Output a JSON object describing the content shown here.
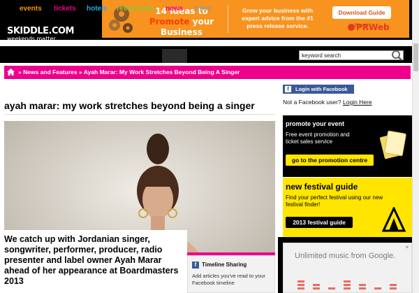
{
  "site": {
    "logo": "SKIDDLE.COM",
    "tagline": "weekends matter"
  },
  "ad": {
    "headline_number": "14 Ideas to",
    "headline_promote": "Promote",
    "headline_rest": "your Business",
    "body": "Grow your business with expert advice from the #1 press release service.",
    "button": "Download Guide Now!",
    "brand": "PRWeb",
    "close": "×"
  },
  "nav": {
    "items": [
      {
        "label": "events",
        "color": "#f7941d"
      },
      {
        "label": "tickets",
        "color": "#ec008c"
      },
      {
        "label": "hotels",
        "color": "#29abe2"
      },
      {
        "label": "restaurants",
        "color": "#8dc63f"
      },
      {
        "label": "news",
        "color": "#ec008c"
      },
      {
        "label": "cities",
        "color": "#999999"
      }
    ],
    "search_placeholder": "keyword search"
  },
  "breadcrumb": {
    "sep1": "»",
    "section": "News and Features",
    "sep2": "»",
    "current": "Ayah Marar: My Work Stretches Beyond Being A Singer"
  },
  "article": {
    "title": "ayah marar: my work stretches beyond being a singer",
    "caption": "We catch up with Jordanian singer, songwriter, performer, producer, radio presenter and label owner Ayah Marar ahead of her appearance at Boardmasters 2013"
  },
  "timeline": {
    "icon": "f",
    "title": "Timeline Sharing",
    "text": "Add articles you've read to your Facebook timeline"
  },
  "facebook": {
    "button": "Login with Facebook",
    "note_prefix": "Not a Facebook user?",
    "note_link": "Login Here"
  },
  "promo": {
    "heading": "promote your event",
    "text": "Free event promotion and ticket sales service",
    "button": "go to the promotion centre"
  },
  "festival": {
    "heading": "new festival guide",
    "text": "Find your perfect festival using our new festival finder!",
    "button": "2013 festival guide"
  },
  "music_ad": {
    "text": "Unlimited music from Google.",
    "close": "×"
  },
  "colors": {
    "pink": "#ec008c",
    "yellow": "#ffe500",
    "orange": "#f7931e",
    "facebook": "#3b5998"
  }
}
